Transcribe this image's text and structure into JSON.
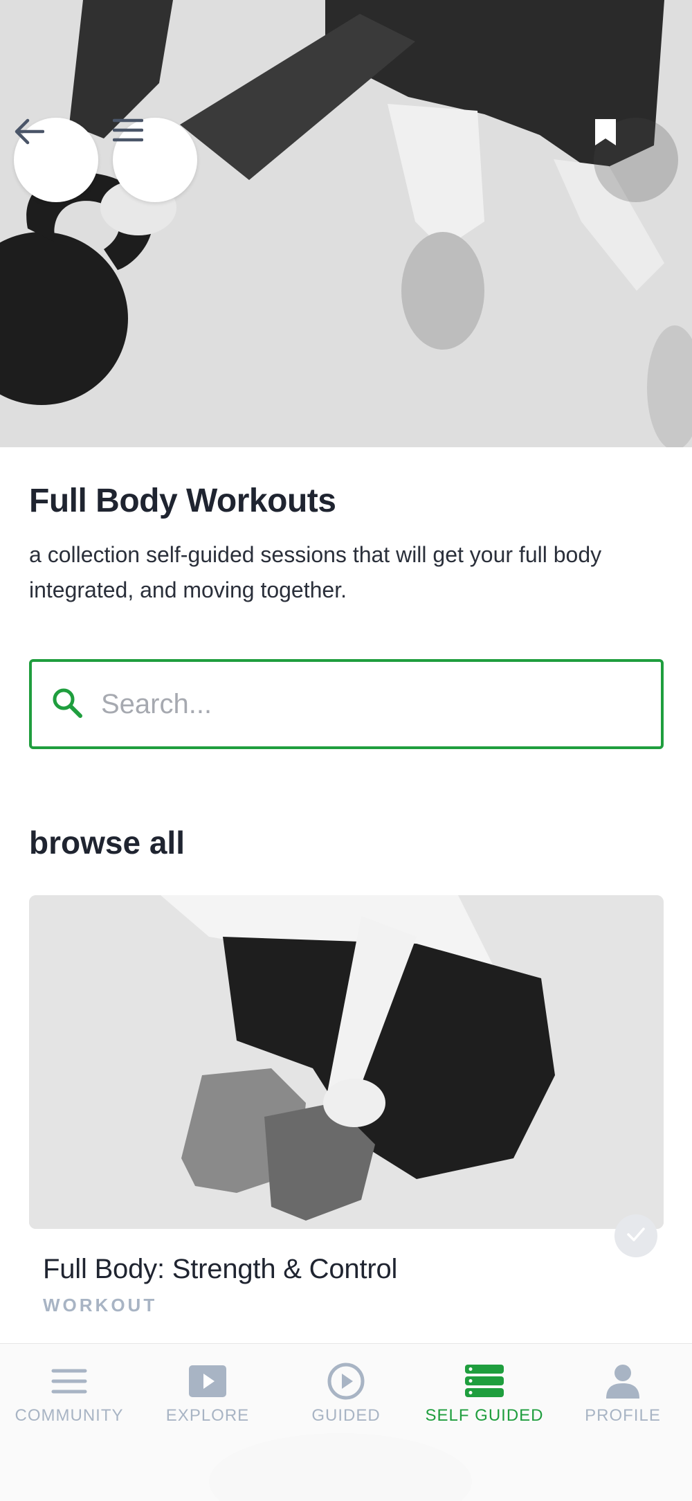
{
  "header": {
    "title": "Full Body Workouts",
    "subtitle": "a collection self-guided sessions that will get your full body integrated, and moving together."
  },
  "hero": {
    "back_icon": "arrow-left-icon",
    "menu_icon": "hamburger-menu-icon",
    "bookmark_icon": "bookmark-icon"
  },
  "search": {
    "placeholder": "Search...",
    "value": "",
    "icon": "search-icon",
    "accent": "#1f9e3e"
  },
  "section": {
    "heading": "browse all"
  },
  "cards": [
    {
      "title": "Full Body: Strength & Control",
      "type": "WORKOUT",
      "completed": true,
      "status_icon": "check-icon"
    }
  ],
  "tabbar": {
    "tabs": [
      {
        "label": "COMMUNITY",
        "icon": "list-icon",
        "active": false
      },
      {
        "label": "EXPLORE",
        "icon": "play-square-icon",
        "active": false
      },
      {
        "label": "GUIDED",
        "icon": "play-circle-icon",
        "active": false
      },
      {
        "label": "SELF GUIDED",
        "icon": "stacked-rows-icon",
        "active": true
      },
      {
        "label": "PROFILE",
        "icon": "person-icon",
        "active": false
      }
    ],
    "active_color": "#1f9e3e",
    "inactive_color": "#a8b4c4"
  }
}
